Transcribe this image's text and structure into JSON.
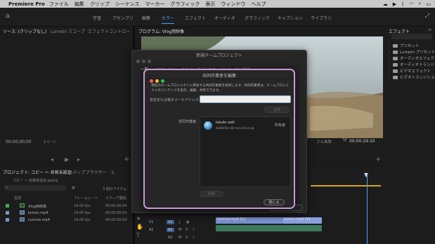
{
  "menubar": {
    "app_name": "Premiere Pro",
    "items": [
      "ファイル",
      "編集",
      "クリップ",
      "シーケンス",
      "マーカー",
      "グラフィック",
      "表示",
      "ウィンドウ",
      "ヘルプ"
    ]
  },
  "workspaces": {
    "tabs": [
      "学習",
      "アセンブリ",
      "編集",
      "カラー",
      "エフェクト",
      "オーディオ",
      "グラフィック",
      "キャプション",
      "ライブラリ"
    ],
    "active": "カラー"
  },
  "source_panel": {
    "tabs": [
      "ソース: (クリップなし)",
      "Lumetri スコープ",
      "エフェクトコントロー"
    ],
    "timecode": "00;00;00;00",
    "page_label": "1ページ"
  },
  "program_panel": {
    "title": "プログラム: Vlog用映像",
    "fit_label": "フル画質",
    "timecode": "00:00:29:10"
  },
  "effects_panel": {
    "title": "エフェクト",
    "items": [
      "プリセット",
      "Lumetri プリセット",
      "オーディオエフェクト",
      "オーディオトランジション",
      "ビデオエフェクト",
      "ビデオトランジション"
    ]
  },
  "project_panel": {
    "tabs": [
      "プロジェクト: コピー 〜 名称未設定",
      "メディアブラウザー",
      "ヒ"
    ],
    "subtitle": "コピー 〜 名称未設定.prproj",
    "item_count": "3 個のアイテム",
    "columns": [
      "名前",
      "フレームレート",
      "メディア開始"
    ],
    "rows": [
      {
        "name": "Vlog用映像",
        "fps": "24.00 fps",
        "start": "00:00:00:00",
        "color": "#3db34a"
      },
      {
        "name": "lemon.mp4",
        "fps": "24.00 fps",
        "start": "00:00:00:00",
        "color": "#7a9ac8"
      },
      {
        "name": "sunrise.mp4",
        "fps": "24.00 fps",
        "start": "00:00:00:00",
        "color": "#7a9ac8"
      }
    ]
  },
  "timeline": {
    "tracks": [
      "V1",
      "A1",
      "A2"
    ],
    "clips": [
      "sunrise.mp4 [V]",
      "lemon.mp4 [V]"
    ]
  },
  "back_dialog": {
    "title": "新規チームプロジェクト",
    "tabs": [
      "一般",
      "オプション",
      "スクラッチディスク",
      "インジェスト設定"
    ]
  },
  "share_dialog": {
    "title": "共同作業者を編集",
    "description": "現在のチームプロジェクトに参加する共同作業者を招待します。共同作業者は、チームプロジェクトのコンテンツを表示、編集、共有できます。",
    "email_label": "名前または電子メールアドレス",
    "email_value": "",
    "add_button": "追加",
    "collaborators_label": "共同作業者:",
    "collaborator_name": "taiuko oott",
    "collaborator_email": "wabi07b+ab+is+uchi.co.jp",
    "collaborator_role": "所有者",
    "delete_button": "削除",
    "close_button": "閉じる"
  }
}
